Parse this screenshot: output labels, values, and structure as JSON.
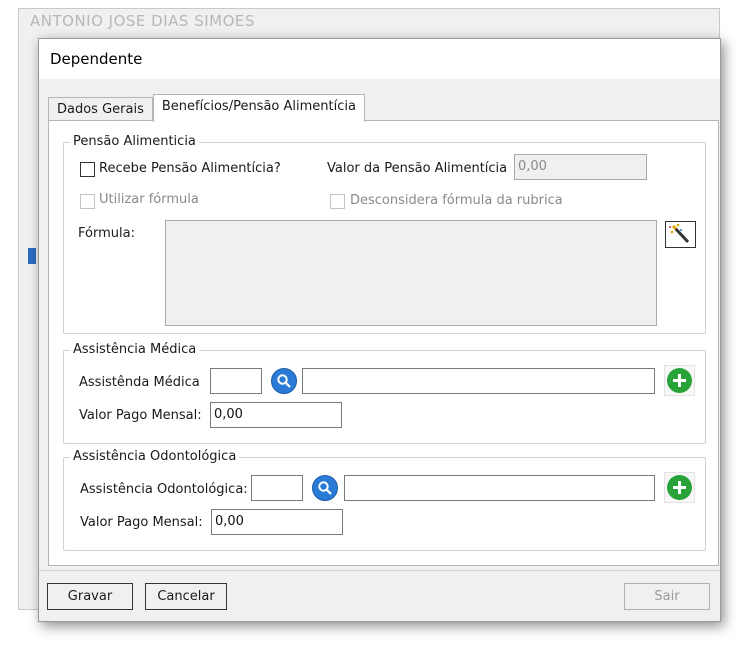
{
  "background": {
    "title": "ANTONIO JOSE DIAS SIMOES"
  },
  "dialog": {
    "title": "Dependente"
  },
  "tabs": [
    {
      "label": "Dados Gerais"
    },
    {
      "label": "Benefícios/Pensão Alimentícia"
    }
  ],
  "pensao": {
    "legend": "Pensão Alimenticia",
    "recebe_label": "Recebe Pensão Alimentícia?",
    "valor_label": "Valor da Pensão Alimentícia",
    "valor_value": "0,00",
    "utilizar_label": "Utilizar fórmula",
    "desconsidera_label": "Desconsidera fórmula da rubrica",
    "formula_label": "Fórmula:"
  },
  "medica": {
    "legend": "Assistência Médica",
    "label": "Assistênda Médica",
    "valor_label": "Valor Pago Mensal:",
    "valor_value": "0,00"
  },
  "odonto": {
    "legend": "Assistência Odontológica",
    "label": "Assistência Odontológica:",
    "valor_label": "Valor Pago Mensal:",
    "valor_value": "0,00"
  },
  "footer": {
    "gravar": "Gravar",
    "cancelar": "Cancelar",
    "sair": "Sair"
  },
  "colors": {
    "search_blue": "#2a7bd5",
    "add_green": "#27a33a"
  }
}
